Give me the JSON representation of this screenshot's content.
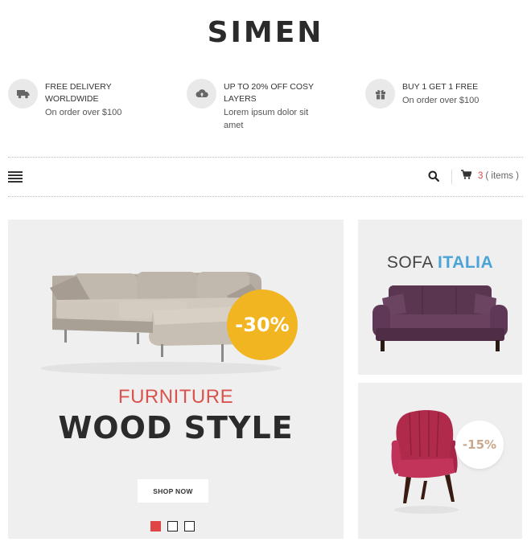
{
  "brand": {
    "logo": "SIMEN"
  },
  "features": [
    {
      "icon": "truck-icon",
      "title": "FREE DELIVERY WORLDWIDE",
      "subtitle": "On order over $100"
    },
    {
      "icon": "cloud-upload-icon",
      "title": "UP TO 20% OFF COSY LAYERS",
      "subtitle": "Lorem ipsum dolor sit amet"
    },
    {
      "icon": "gift-icon",
      "title": "BUY 1 GET 1 FREE",
      "subtitle": "On order over $100"
    }
  ],
  "nav": {
    "menu_icon": "hamburger-menu-icon",
    "search_icon": "search-icon",
    "cart_icon": "shopping-cart-icon",
    "cart_count": "3",
    "cart_label": "( items )"
  },
  "slider": {
    "discount": "-30%",
    "subtitle": "FURNITURE",
    "title": "WOOD STYLE",
    "button": "SHOP NOW",
    "slides": 3,
    "active_slide": 1
  },
  "banners": [
    {
      "title_part1": "SOFA",
      "title_part2": "ITALIA"
    },
    {
      "discount": "-15%"
    }
  ],
  "colors": {
    "accent_red": "#e04545",
    "badge_yellow": "#f2b522",
    "italia_blue": "#4aa4d8",
    "badge_tan": "#c9a88d",
    "panel_bg": "#efefef"
  }
}
